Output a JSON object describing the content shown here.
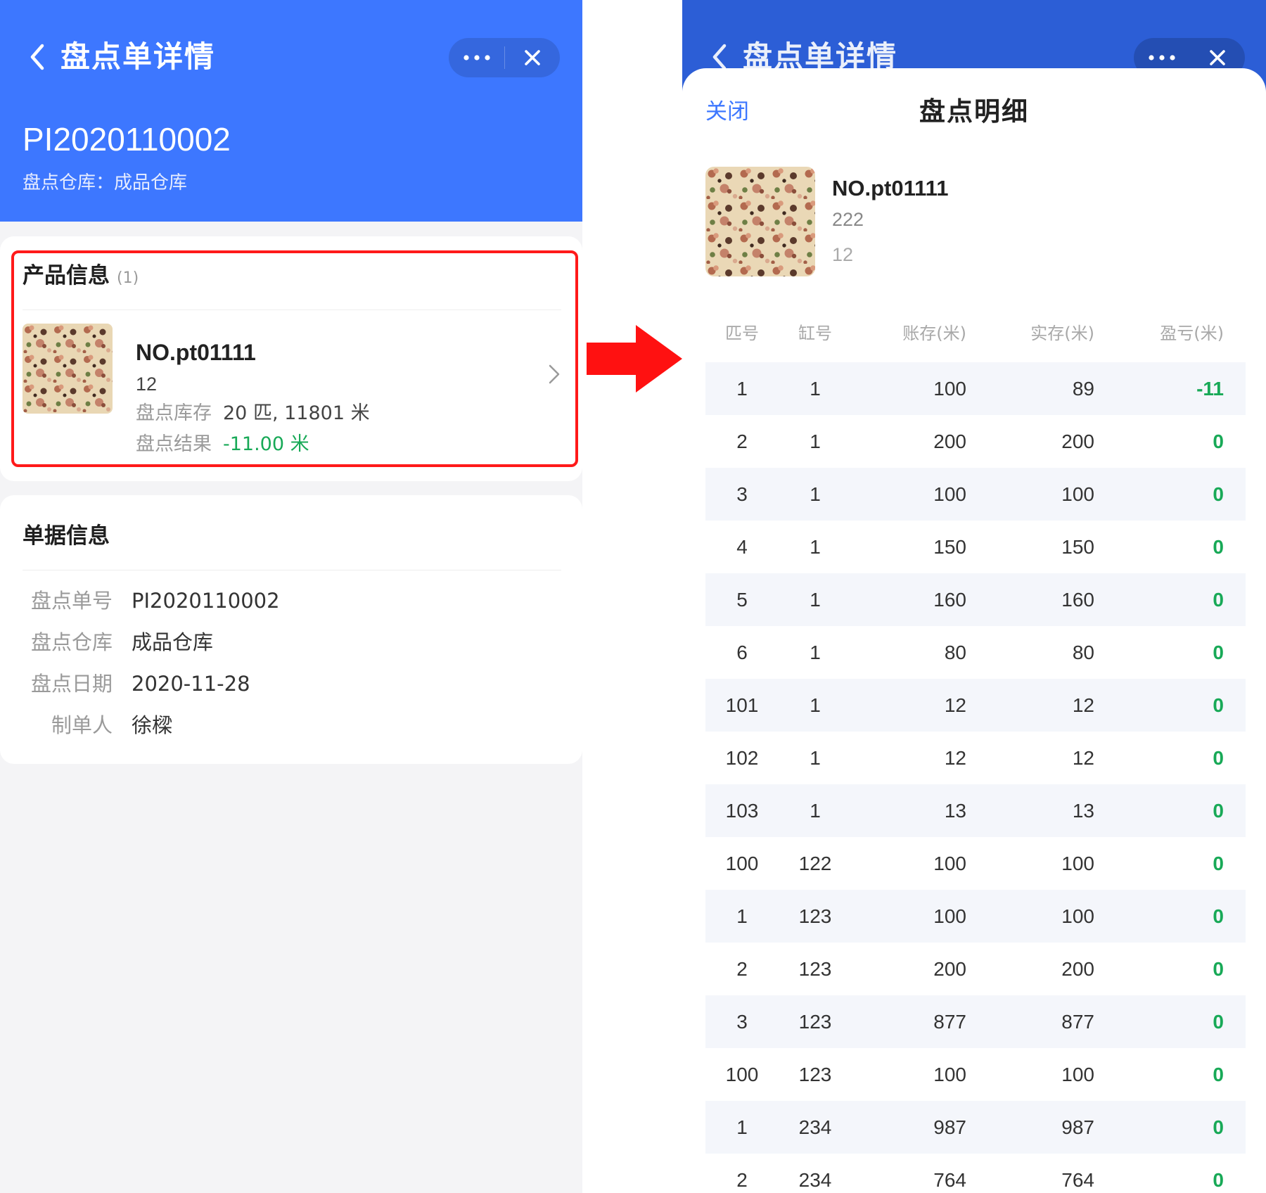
{
  "left": {
    "nav": {
      "title": "盘点单详情"
    },
    "header": {
      "order_no": "PI2020110002",
      "warehouse_line": "盘点仓库：成品仓库"
    },
    "product_section": {
      "title": "产品信息",
      "count": "(1)",
      "item": {
        "name": "NO.pt01111",
        "spec": "12",
        "stock_label": "盘点库存",
        "stock_value": "20 匹, 11801 米",
        "result_label": "盘点结果",
        "result_value": "-11.00 米"
      }
    },
    "doc_section": {
      "title": "单据信息",
      "rows": [
        {
          "label": "盘点单号",
          "value": "PI2020110002"
        },
        {
          "label": "盘点仓库",
          "value": "成品仓库"
        },
        {
          "label": "盘点日期",
          "value": "2020-11-28"
        },
        {
          "label": "制单人",
          "value": "徐樑"
        }
      ]
    }
  },
  "right": {
    "nav": {
      "title": "盘点单详情"
    },
    "sheet": {
      "close_label": "关闭",
      "title": "盘点明细",
      "product": {
        "name": "NO.pt01111",
        "line1": "222",
        "line2": "12"
      },
      "table": {
        "columns": [
          "匹号",
          "缸号",
          "账存(米)",
          "实存(米)",
          "盈亏(米)"
        ],
        "rows": [
          [
            "1",
            "1",
            "100",
            "89",
            "-11"
          ],
          [
            "2",
            "1",
            "200",
            "200",
            "0"
          ],
          [
            "3",
            "1",
            "100",
            "100",
            "0"
          ],
          [
            "4",
            "1",
            "150",
            "150",
            "0"
          ],
          [
            "5",
            "1",
            "160",
            "160",
            "0"
          ],
          [
            "6",
            "1",
            "80",
            "80",
            "0"
          ],
          [
            "101",
            "1",
            "12",
            "12",
            "0"
          ],
          [
            "102",
            "1",
            "12",
            "12",
            "0"
          ],
          [
            "103",
            "1",
            "13",
            "13",
            "0"
          ],
          [
            "100",
            "122",
            "100",
            "100",
            "0"
          ],
          [
            "1",
            "123",
            "100",
            "100",
            "0"
          ],
          [
            "2",
            "123",
            "200",
            "200",
            "0"
          ],
          [
            "3",
            "123",
            "877",
            "877",
            "0"
          ],
          [
            "100",
            "123",
            "100",
            "100",
            "0"
          ],
          [
            "1",
            "234",
            "987",
            "987",
            "0"
          ],
          [
            "2",
            "234",
            "764",
            "764",
            "0"
          ]
        ]
      }
    }
  },
  "colors": {
    "brand_blue": "#3d77ff",
    "header_blue_dim": "#2c5ed6",
    "profit_green": "#18a957",
    "highlight_red": "#ff1a1a",
    "link_blue": "#3d77ff"
  },
  "icons": {
    "back": "chevron-left-icon",
    "more": "more-dots-icon",
    "close": "close-icon",
    "row_arrow": "chevron-right-icon",
    "flow_arrow": "right-arrow-icon"
  }
}
